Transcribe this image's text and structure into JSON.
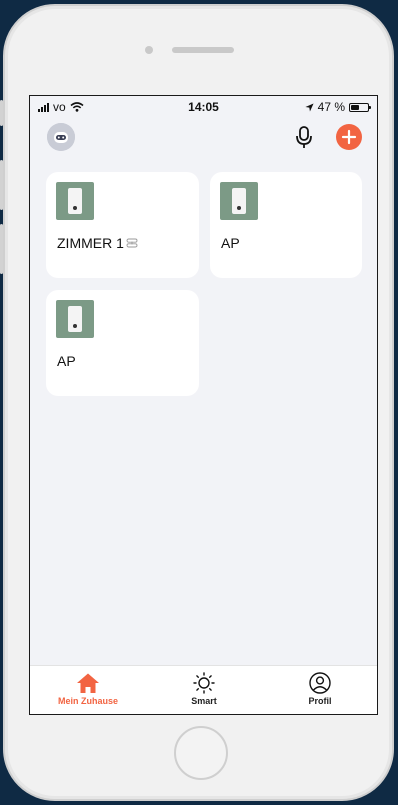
{
  "status_bar": {
    "carrier": "vo",
    "time": "14:05",
    "battery_percent": "47 %",
    "battery_level": 0.47
  },
  "header": {
    "avatar_icon": "robot-avatar-icon",
    "mic_icon": "microphone-icon",
    "add_icon": "plus-icon"
  },
  "devices": [
    {
      "name": "ZIMMER 1",
      "linked": true
    },
    {
      "name": "AP",
      "linked": false
    },
    {
      "name": "AP",
      "linked": false
    }
  ],
  "tabs": [
    {
      "label": "Mein Zuhause",
      "icon": "home-icon",
      "active": true
    },
    {
      "label": "Smart",
      "icon": "sun-icon",
      "active": false
    },
    {
      "label": "Profil",
      "icon": "profile-icon",
      "active": false
    }
  ],
  "colors": {
    "accent": "#f26442",
    "background": "#f2f3f7",
    "card": "#ffffff"
  }
}
